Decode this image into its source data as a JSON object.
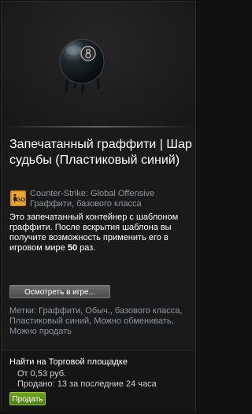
{
  "item": {
    "title": "Запечатанный граффити | Шар судьбы (Пластиковый синий)",
    "game_name": "Counter-Strike: Global Offensive",
    "item_type": "Граффити, базового класса",
    "icon_label": "GO",
    "description_prefix": "Это запечатанный контейнер с шаблоном граффити. После вскрытия шаблона вы получите возможность применить его в игровом мире ",
    "description_count": "50",
    "description_suffix": " раз."
  },
  "buttons": {
    "inspect_label": "Осмотреть в игре...",
    "sell_label": "Продать"
  },
  "tags": {
    "text": "Метки: Граффити, Обыч., базового класса, Пластиковый синий, Можно обменивать, Можно продать"
  },
  "market": {
    "title": "Найти на Торговой площадке",
    "price": "От 0,53 руб.",
    "sold": "Продано: 13 за последние 24 часа"
  },
  "colors": {
    "accent_green": "#6ea21a",
    "muted_text": "#8f98a0"
  }
}
